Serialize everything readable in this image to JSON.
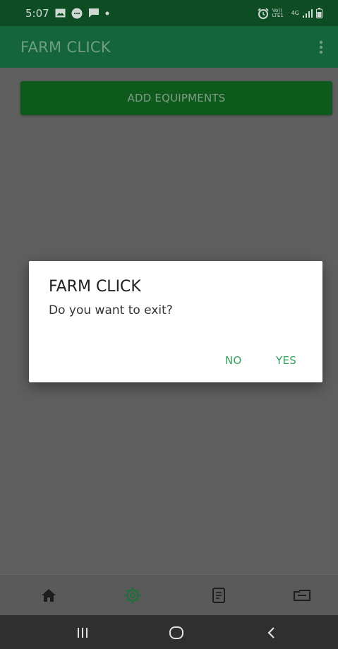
{
  "status_bar": {
    "time": "5:07",
    "left_icons": [
      "gallery-icon",
      "chat-bubble-icon",
      "message-icon",
      "dot-icon"
    ],
    "right_icons": [
      "alarm-icon",
      "volte-icon",
      "4g-icon",
      "signal-icon",
      "battery-icon"
    ],
    "volte_label": "Vo)) LTE1",
    "network_label": "4G"
  },
  "app_bar": {
    "title": "FARM CLICK",
    "menu_icon": "more-vert-icon"
  },
  "main": {
    "add_button_label": "ADD EQUIPMENTS"
  },
  "dialog": {
    "title": "FARM CLICK",
    "message": "Do you want to exit?",
    "no_label": "NO",
    "yes_label": "YES"
  },
  "bottom_nav": {
    "items": [
      {
        "icon": "home-icon",
        "active": false
      },
      {
        "icon": "gear-icon",
        "active": true
      },
      {
        "icon": "document-icon",
        "active": false
      },
      {
        "icon": "ticket-icon",
        "active": false
      }
    ]
  },
  "system_nav": {
    "buttons": [
      "recents-icon",
      "home-circle-icon",
      "back-icon"
    ]
  },
  "colors": {
    "status_bar": "#0e4d24",
    "app_bar": "#14663a",
    "button": "#0e5a1c",
    "accent": "#2fa45c",
    "scrim_background": "#5f5f5f"
  }
}
